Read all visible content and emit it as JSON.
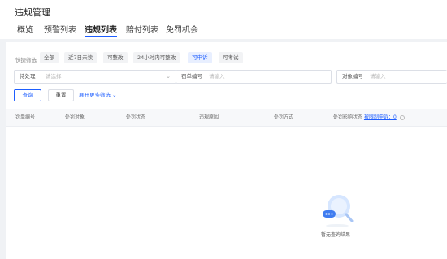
{
  "page": {
    "title": "违规管理"
  },
  "tabs": [
    {
      "label": "概览"
    },
    {
      "label": "预警列表"
    },
    {
      "label": "违规列表"
    },
    {
      "label": "赔付列表"
    },
    {
      "label": "免罚机会"
    }
  ],
  "active_tab": "违规列表",
  "quick_filter": {
    "label": "快捷筛选",
    "chips": [
      "全部",
      "近7日未读",
      "可整改",
      "24小时内可整改",
      "可申诉",
      "可考试"
    ],
    "active": "可申诉"
  },
  "filters": {
    "status": {
      "label": "待处理",
      "placeholder": "请选择"
    },
    "ticket_no": {
      "label": "罚单编号",
      "placeholder": "请输入"
    },
    "object_no": {
      "label": "对象编号",
      "placeholder": "请输入"
    }
  },
  "actions": {
    "query": "查询",
    "reset": "重置",
    "expand": "展开更多筛选"
  },
  "table": {
    "columns": [
      "罚单编号",
      "处罚对象",
      "处罚状态",
      "违规原因",
      "处罚方式",
      "处罚影响状态"
    ],
    "extra": "被限制申诉：0"
  },
  "empty": {
    "text": "暂无查询结果"
  },
  "colors": {
    "accent": "#1e5eff",
    "background": "#f0f2f5"
  }
}
